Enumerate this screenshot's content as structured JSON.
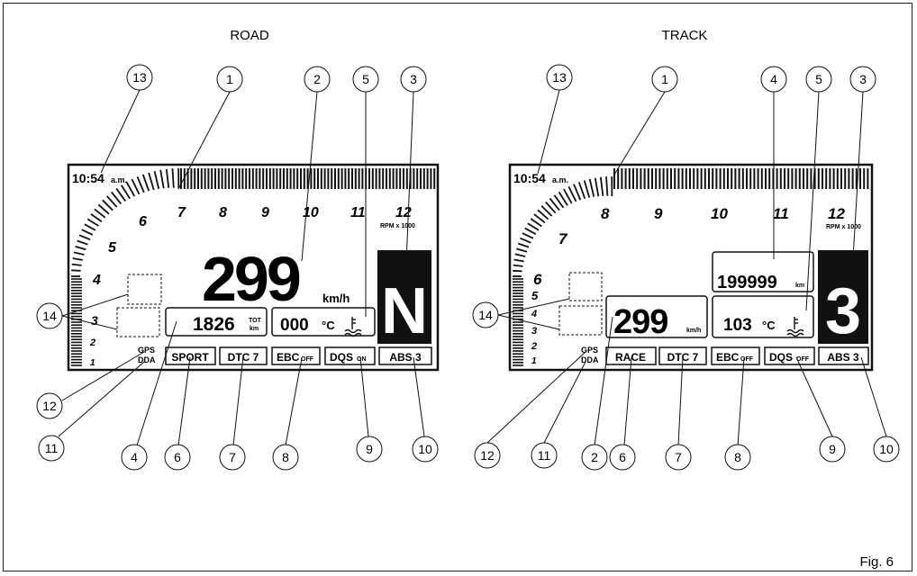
{
  "figure_label": "Fig. 6",
  "road": {
    "title": "ROAD",
    "clock": "10:54",
    "clock_suffix": "a.m.",
    "scale_numbers": [
      "1",
      "2",
      "3",
      "4",
      "5",
      "6",
      "7",
      "8",
      "9",
      "10",
      "11",
      "12"
    ],
    "rpm_unit": "RPM x 1000",
    "speed": "299",
    "speed_unit": "km/h",
    "gear": "N",
    "odometer": "1826",
    "odo_unit_top": "TOT",
    "odo_unit_bottom": "km",
    "temp": "000",
    "temp_unit": "°C",
    "gps": "GPS",
    "dda": "DDA",
    "mode": "SPORT",
    "dtc": "DTC 7",
    "ebc": "EBC",
    "ebc_state": "OFF",
    "dqs": "DQS",
    "dqs_state": "ON",
    "abs": "ABS 3",
    "callouts": [
      "13",
      "1",
      "2",
      "5",
      "3",
      "14",
      "12",
      "11",
      "4",
      "6",
      "7",
      "8",
      "9",
      "10"
    ]
  },
  "track": {
    "title": "TRACK",
    "clock": "10:54",
    "clock_suffix": "a.m.",
    "scale_numbers": [
      "1",
      "2",
      "3",
      "4",
      "5",
      "6",
      "7",
      "8",
      "9",
      "10",
      "11",
      "12"
    ],
    "rpm_unit": "RPM x 1000",
    "speed": "299",
    "speed_unit": "km/h",
    "gear": "3",
    "lap": "199999",
    "lap_unit": "km",
    "temp": "103",
    "temp_unit": "°C",
    "gps": "GPS",
    "dda": "DDA",
    "mode": "RACE",
    "dtc": "DTC 7",
    "ebc": "EBC",
    "ebc_state": "OFF",
    "dqs": "DQS",
    "dqs_state": "OFF",
    "abs": "ABS 3",
    "callouts": [
      "13",
      "1",
      "4",
      "5",
      "3",
      "14",
      "12",
      "11",
      "2",
      "6",
      "7",
      "8",
      "9",
      "10"
    ]
  }
}
